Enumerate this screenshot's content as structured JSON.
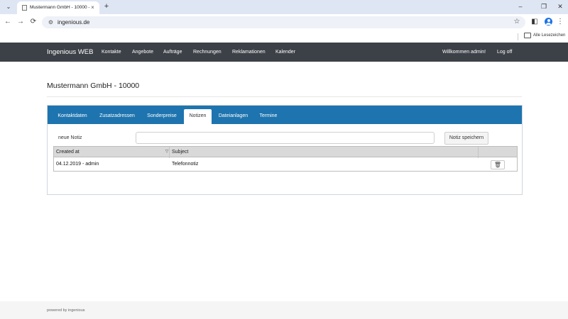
{
  "browser": {
    "tab_title": "Mustermann GmbH - 10000 - I",
    "tab_close": "×",
    "new_tab": "+",
    "url": "ingenious.de",
    "bookmarks_label": "Alle Lesezeichen",
    "icons": {
      "tab_dropdown": "⌄",
      "back": "←",
      "forward": "→",
      "reload": "⟳",
      "site_info": "⚙",
      "star": "☆",
      "side_panel": "◧",
      "menu": "⋮",
      "minimize": "–",
      "maximize": "❐",
      "close": "✕"
    }
  },
  "navbar": {
    "brand": "Ingenious WEB",
    "links": [
      "Kontakte",
      "Angebote",
      "Aufträge",
      "Rechnungen",
      "Reklamationen",
      "Kalender"
    ],
    "welcome": "Willkommen admin!",
    "logoff": "Log off"
  },
  "page": {
    "title": "Mustermann GmbH - 10000"
  },
  "tabs": {
    "items": [
      "Kontaktdaten",
      "Zusatzadressen",
      "Sonderpreise",
      "Notizen",
      "Dateianlagen",
      "Termine"
    ],
    "active": "Notizen"
  },
  "note_form": {
    "label": "neue Notiz",
    "value": "",
    "placeholder": "",
    "save_label": "Notiz speichern"
  },
  "grid": {
    "columns": [
      "Created at",
      "Subject",
      ""
    ],
    "sort_icon": "▽",
    "rows": [
      {
        "created_at": "04.12.2019 - admin",
        "subject": "Telefonnotiz",
        "action_icon": "🗑"
      }
    ]
  },
  "footer": {
    "text": "powered by ingenious"
  },
  "colors": {
    "navbar": "#3c4047",
    "tabs_bar": "#1e74ae",
    "grid_header": "#d9d9d9"
  }
}
